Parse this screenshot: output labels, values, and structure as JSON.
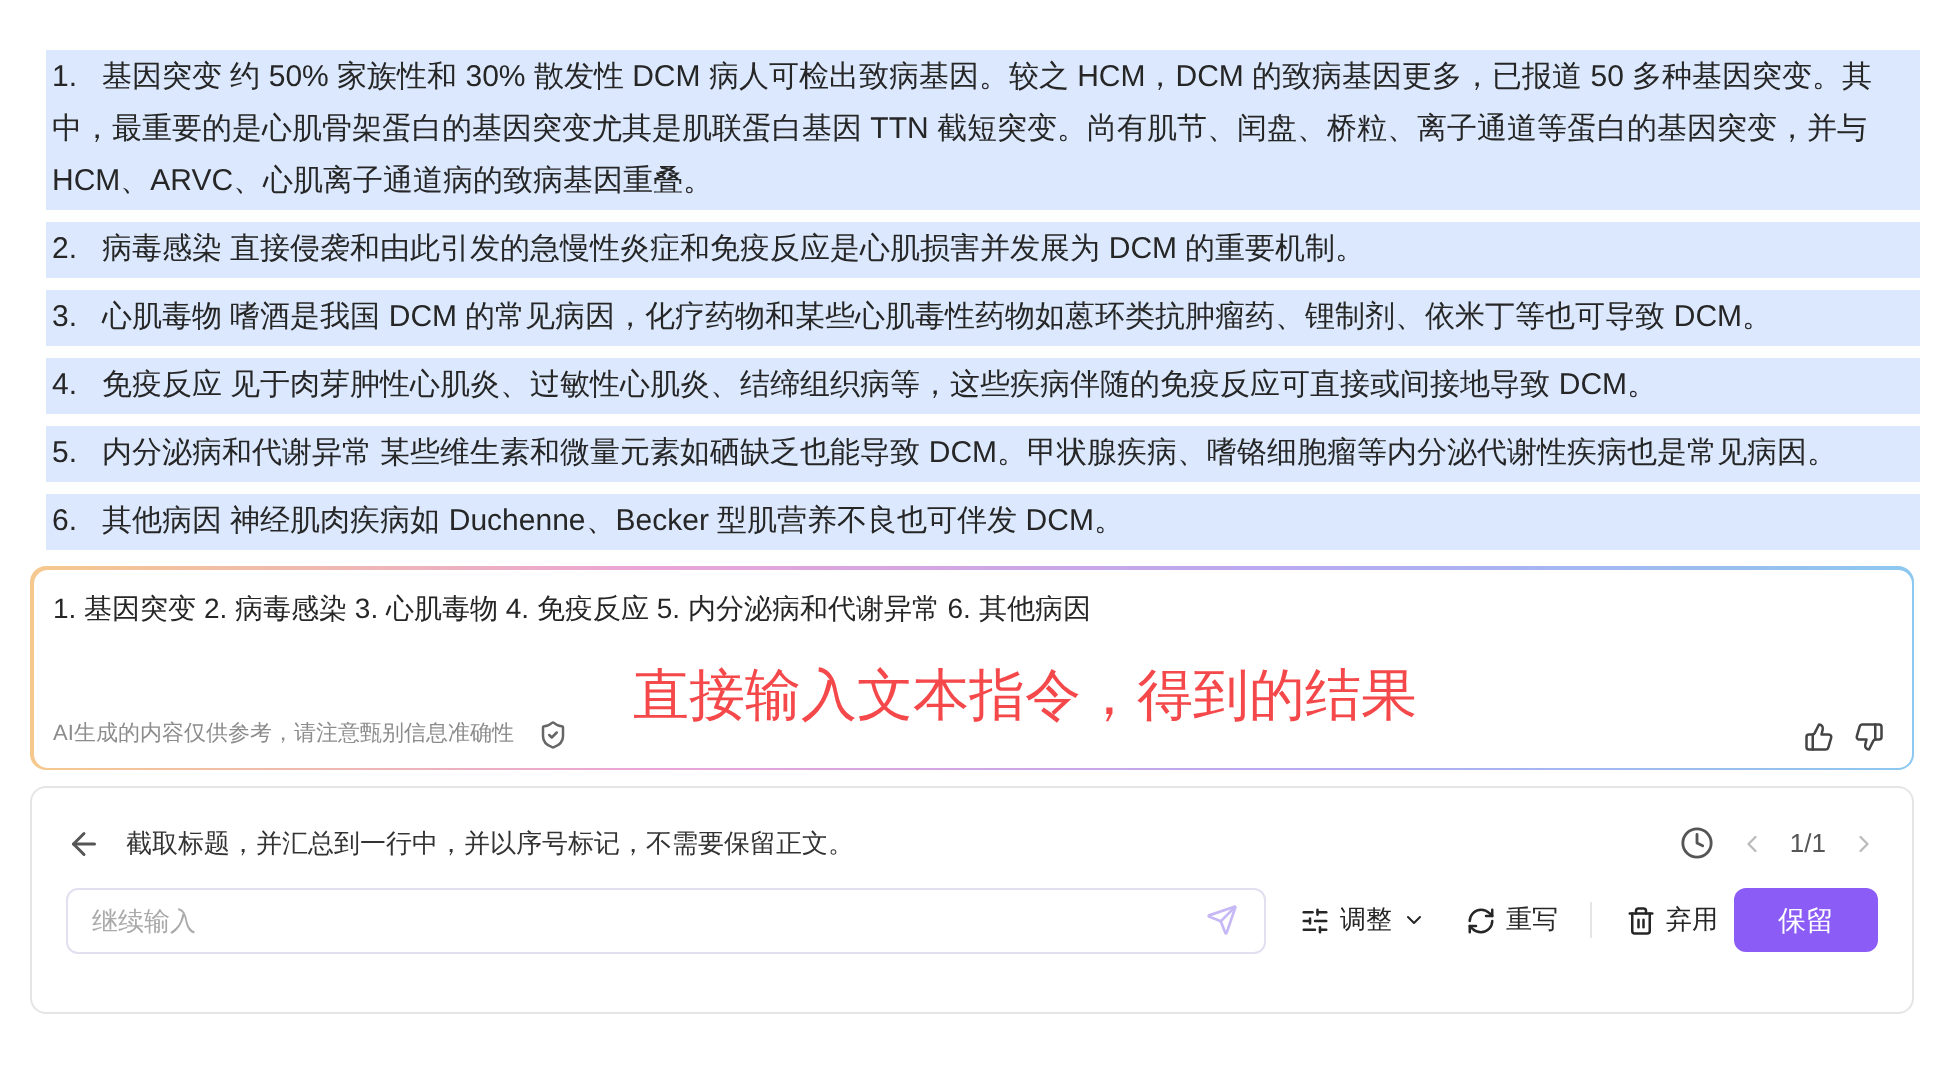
{
  "paragraphs": [
    {
      "number": "1.",
      "title": "基因突变",
      "body": "约 50% 家族性和 30% 散发性 DCM 病人可检出致病基因。较之 HCM，DCM 的致病基因更多，已报道 50 多种基因突变。其中，最重要的是心肌骨架蛋白的基因突变尤其是肌联蛋白基因 TTN 截短突变。尚有肌节、闰盘、桥粒、离子通道等蛋白的基因突变，并与 HCM、ARVC、心肌离子通道病的致病基因重叠。"
    },
    {
      "number": "2.",
      "title": "病毒感染",
      "body": "直接侵袭和由此引发的急慢性炎症和免疫反应是心肌损害并发展为 DCM 的重要机制。"
    },
    {
      "number": "3.",
      "title": "心肌毒物",
      "body": "嗜酒是我国 DCM 的常见病因，化疗药物和某些心肌毒性药物如蒽环类抗肿瘤药、锂制剂、依米丁等也可导致 DCM。"
    },
    {
      "number": "4.",
      "title": "免疫反应",
      "body": "见于肉芽肿性心肌炎、过敏性心肌炎、结缔组织病等，这些疾病伴随的免疫反应可直接或间接地导致 DCM。"
    },
    {
      "number": "5.",
      "title": "内分泌病和代谢异常",
      "body": "某些维生素和微量元素如硒缺乏也能导致 DCM。甲状腺疾病、嗜铬细胞瘤等内分泌代谢性疾病也是常见病因。"
    },
    {
      "number": "6.",
      "title": "其他病因",
      "body": "神经肌肉疾病如 Duchenne、Becker 型肌营养不良也可伴发 DCM。"
    }
  ],
  "result": {
    "text": "1.  基因突变 2. 病毒感染 3. 心肌毒物 4. 免疫反应 5. 内分泌病和代谢异常 6. 其他病因",
    "annotation": "直接输入文本指令，得到的结果",
    "disclaimer": "AI生成的内容仅供参考，请注意甄别信息准确性"
  },
  "prompt_panel": {
    "instruction": "截取标题，并汇总到一行中，并以序号标记，不需要保留正文。",
    "page": "1/1",
    "input": {
      "placeholder": "继续输入"
    },
    "adjust": "调整",
    "rewrite": "重写",
    "discard": "弃用",
    "keep": "保留"
  }
}
